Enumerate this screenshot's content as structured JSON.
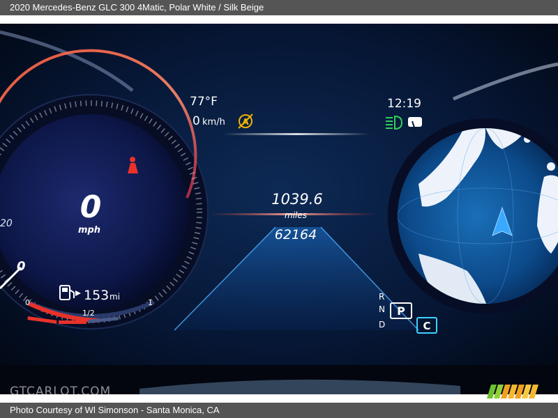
{
  "header": {
    "title": "2020 Mercedes-Benz GLC 300 4Matic,  Polar White / Silk Beige"
  },
  "footer": {
    "credit": "Photo Courtesy of Wl Simonson - Santa Monica, CA"
  },
  "watermark": {
    "text": "GTCARLOT.COM"
  },
  "cluster": {
    "temperature": "77°F",
    "speed_limit": "0",
    "speed_limit_unit": "km/h",
    "clock": "12:19",
    "trip_distance": "1039.6",
    "trip_unit": "miles",
    "odometer": "62164",
    "speed": "0",
    "speed_unit": "mph",
    "range": "153",
    "range_unit": "mi",
    "gauge_label_20": "20",
    "gauge_label_0": "0",
    "fuel_empty": "0",
    "fuel_half": "1/2",
    "fuel_full": "1",
    "gear_r": "R",
    "gear_n": "N",
    "gear_d": "D",
    "gear_p": "P",
    "drive_mode": "C",
    "colors": {
      "accent_blue": "#2f8df0",
      "needle_red": "#e8322a",
      "indicator_green": "#2fd05a",
      "indicator_yellow": "#f0b400",
      "mode_cyan": "#3fd0ff"
    },
    "icons": [
      "seatbelt-warning-icon",
      "stop-start-off-icon",
      "low-beam-icon",
      "washer-icon",
      "fuel-pump-icon",
      "navigation-arrow-icon"
    ]
  }
}
